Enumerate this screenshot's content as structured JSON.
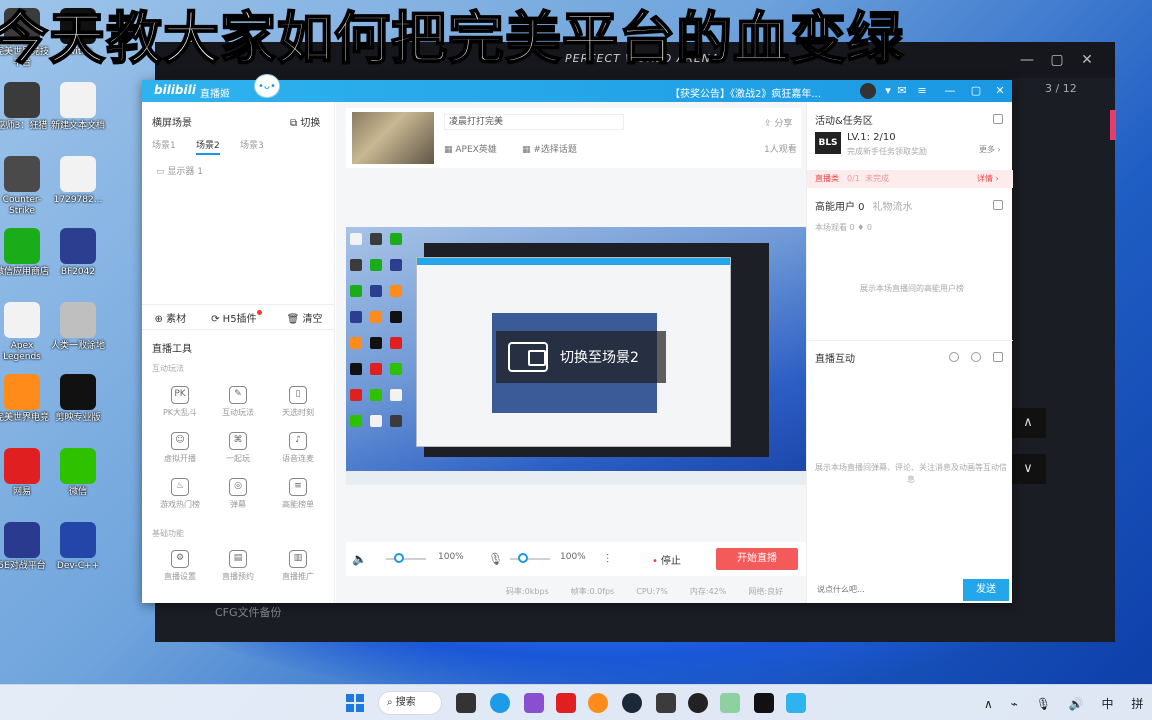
{
  "headline": "今天教大家如何把完美平台的血变绿",
  "desktop_icons": [
    {
      "label": "完美世界竞技平台",
      "color": "#3b3b3b"
    },
    {
      "label": "Twitch",
      "color": "#111"
    },
    {
      "label": "巫师3：狂猎",
      "color": "#3b3b3b"
    },
    {
      "label": "新建文本文档",
      "color": "#f2f2f2"
    },
    {
      "label": "Counter-Strike",
      "color": "#4a4a4a"
    },
    {
      "label": "1729782...",
      "color": "#f2f2f2"
    },
    {
      "label": "微信应用商店",
      "color": "#1aad19"
    },
    {
      "label": "BF2042",
      "color": "#2c3e8f"
    },
    {
      "label": "Apex Legends",
      "color": "#f2f2f2"
    },
    {
      "label": "人类一败涂地",
      "color": "#bfbfbf"
    },
    {
      "label": "完美世界电竞",
      "color": "#ff8c1a"
    },
    {
      "label": "剪映专业版",
      "color": "#111"
    },
    {
      "label": "网易",
      "color": "#e02020"
    },
    {
      "label": "微信",
      "color": "#2dc100"
    },
    {
      "label": "5E对战平台",
      "color": "#2a3a8f"
    },
    {
      "label": "Dev-C++",
      "color": "#2446a8"
    }
  ],
  "bg_window": {
    "brand": "PERFECT WORLD ARENA",
    "counter": "3 / 12",
    "files": "CFG文件备份"
  },
  "app": {
    "title_logo": "bilibili",
    "title_name": "直播姬",
    "mascot": "•ᴗ•",
    "notice": "【获奖公告】《激战2》疯狂嘉年...",
    "left": {
      "scene_header": "横屏场景",
      "switch_label": "切换",
      "scene_tabs": [
        "场景1",
        "场景2",
        "场景3"
      ],
      "scene_item": "显示器 1",
      "mid_bar": [
        "素材",
        "H5插件",
        "清空"
      ],
      "tools_title": "直播工具",
      "interactive_label": "互动玩法",
      "tools": [
        {
          "label": "PK大乱斗",
          "icon": "pk-icon",
          "glyph": "PK"
        },
        {
          "label": "互动玩法",
          "icon": "interactive-icon",
          "glyph": "✎"
        },
        {
          "label": "天选时刻",
          "icon": "gift-icon",
          "glyph": "▯"
        },
        {
          "label": "虚拟开播",
          "icon": "avatar-icon",
          "glyph": "☺"
        },
        {
          "label": "一起玩",
          "icon": "gamepad-icon",
          "glyph": "⌘"
        },
        {
          "label": "语音连麦",
          "icon": "mic-link-icon",
          "glyph": "♪"
        },
        {
          "label": "游戏热门榜",
          "icon": "rank-icon",
          "glyph": "♨"
        },
        {
          "label": "弹幕",
          "icon": "bullet-icon",
          "glyph": "◎"
        },
        {
          "label": "高能榜单",
          "icon": "list-icon",
          "glyph": "≡"
        }
      ],
      "basic_label": "基础功能",
      "basic_tools": [
        {
          "label": "直播设置",
          "icon": "gear-icon",
          "glyph": "⚙"
        },
        {
          "label": "直播预约",
          "icon": "calendar-icon",
          "glyph": "▤"
        },
        {
          "label": "直播推广",
          "icon": "promote-icon",
          "glyph": "▥"
        }
      ]
    },
    "center": {
      "room_title": "凌晨打打完美",
      "share": "分享",
      "category": "APEX英雄",
      "topic": "#选择话题",
      "viewers": "1人观看",
      "toast": "切换至场景2",
      "speaker_percent": "100%",
      "mic_percent": "100%",
      "speaker_level": 100,
      "mic_level": 100,
      "stop_label": "停止",
      "start_label": "开始直播",
      "status": [
        "码率:0kbps",
        "帧率:0.0fps",
        "CPU:7%",
        "内存:42%",
        "网络:良好"
      ]
    },
    "right": {
      "title": "活动&任务区",
      "bls": "BLS",
      "level": "LV.1:  2/10",
      "level_sub": "完成新手任务领取奖励",
      "more": "更多 ›",
      "task_type": "直播类",
      "task_count": "0/1",
      "task_label": "未完成",
      "task_detail": "详情 ›",
      "hv_tab1": "高能用户 0",
      "hv_tab2": "礼物流水",
      "hv_stats": "本场观看  0    ♦ 0",
      "hv_empty": "展示本场直播间的高能用户榜",
      "chat_title": "直播互动",
      "chat_empty": "展示本场直播间弹幕、评论、关注消息及动画等互动信息",
      "chat_placeholder": "说点什么吧...",
      "send_label": "发送"
    }
  },
  "taskbar": {
    "search": "搜索",
    "tray": [
      "∧",
      "中",
      "拼"
    ]
  }
}
